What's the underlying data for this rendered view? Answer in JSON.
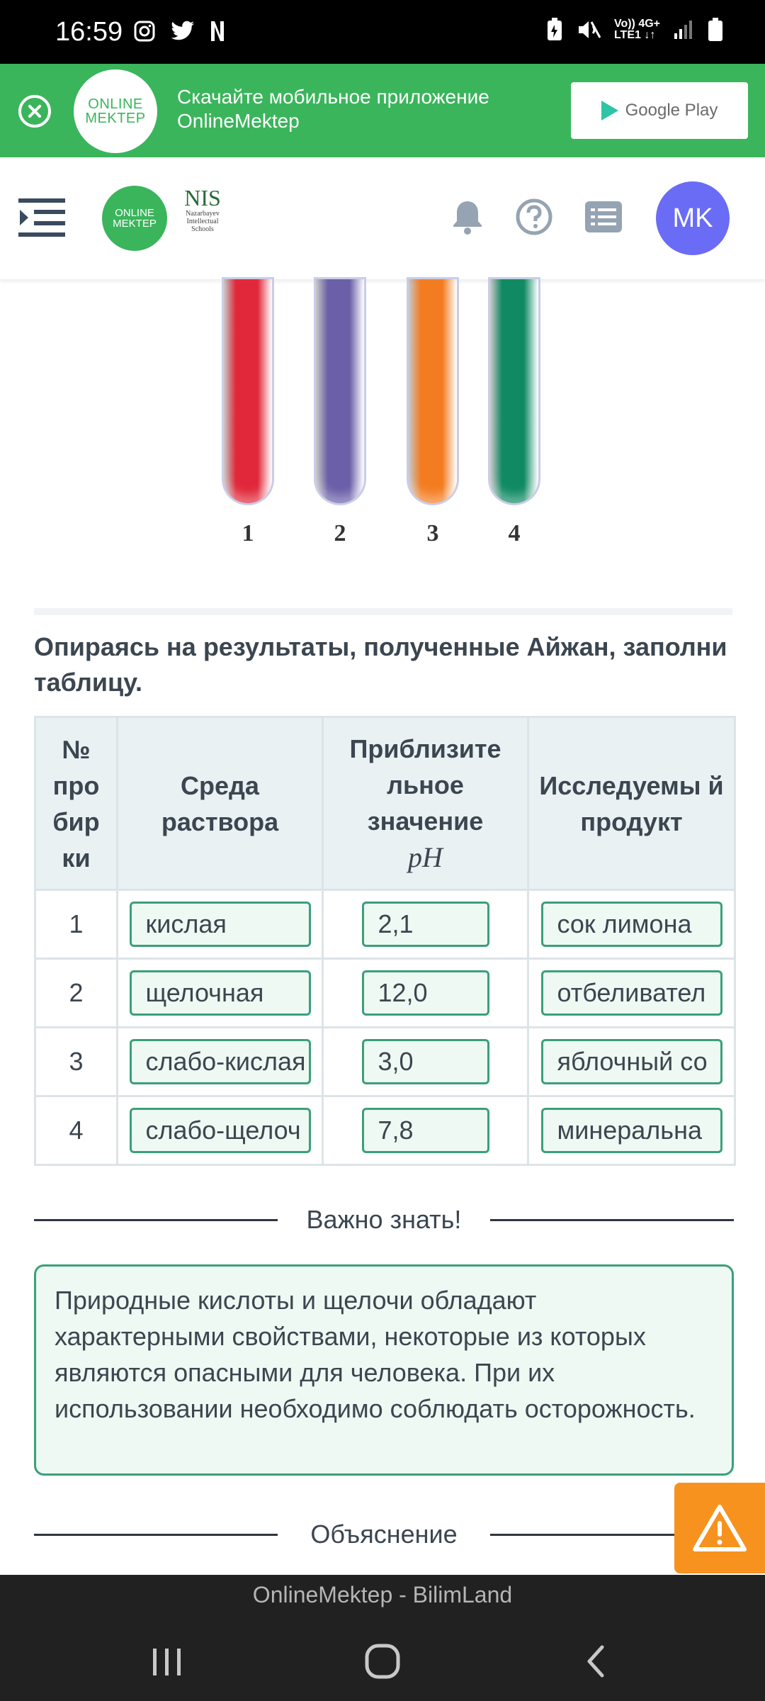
{
  "status_bar": {
    "time": "16:59",
    "network_top": "Vo)) 4G+",
    "network_bottom": "LTE1 ↓↑"
  },
  "banner": {
    "logo_line1": "ONLINE",
    "logo_line2": "MEKTEP",
    "text_line1": "Скачайте мобильное приложение",
    "text_line2": "OnlineMektep",
    "store_label": "Google Play"
  },
  "header": {
    "logo_line1": "ONLINE",
    "logo_line2": "MEKTEP",
    "nis_title": "NIS",
    "nis_sub1": "Nazarbayev",
    "nis_sub2": "Intellectual",
    "nis_sub3": "Schools",
    "avatar_initials": "MK",
    "icons": [
      "menu-icon",
      "bell-icon",
      "help-icon",
      "list-icon"
    ]
  },
  "tubes": [
    {
      "label": "1",
      "color": "#e0283a"
    },
    {
      "label": "2",
      "color": "#6a5fa8"
    },
    {
      "label": "3",
      "color": "#f47c20"
    },
    {
      "label": "4",
      "color": "#0f8a62"
    }
  ],
  "question": "Опираясь на результаты, полученные Айжан, заполни таблицу.",
  "table": {
    "headers": {
      "col1": "№ про бир ки",
      "col2": "Среда раствора",
      "col3": "Приблизите льное значение",
      "col3_math": "pH",
      "col4": "Исследуемы й продукт"
    },
    "rows": [
      {
        "num": "1",
        "medium": "кислая",
        "ph": "2,1",
        "product": "сок лимона"
      },
      {
        "num": "2",
        "medium": "щелочная",
        "ph": "12,0",
        "product": "отбеливател"
      },
      {
        "num": "3",
        "medium": "слабо-кислая",
        "ph": "3,0",
        "product": "яблочный со"
      },
      {
        "num": "4",
        "medium": "слабо-щелоч",
        "ph": "7,8",
        "product": "минеральна"
      }
    ]
  },
  "important": {
    "title": "Важно знать!",
    "text": "Природные кислоты и щелочи обладают характерными свойствами, некоторые из которых являются опасными для человека. При их использовании необходимо соблюдать осторожность."
  },
  "explanation_title": "Объяснение",
  "app_title": "OnlineMektep - BilimLand",
  "colors": {
    "brand_green": "#3ab55b",
    "answer_border": "#3aa07a",
    "answer_bg": "#eef9f3",
    "avatar": "#6a6cf6",
    "warning": "#f7921e"
  }
}
